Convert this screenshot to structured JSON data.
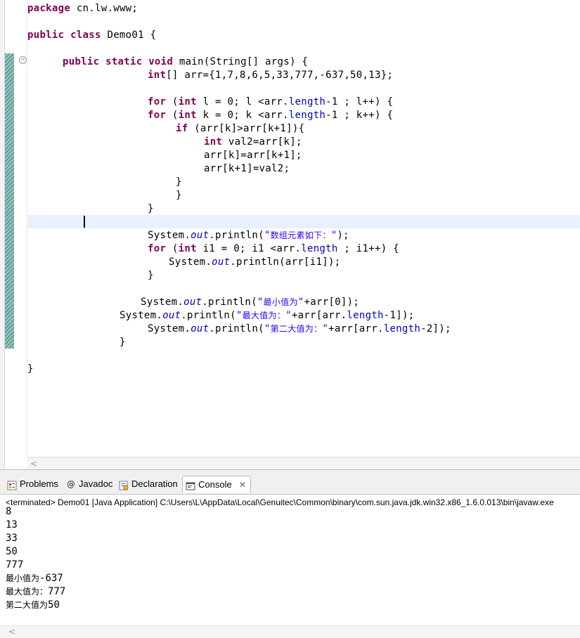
{
  "editor": {
    "fold_toggle": "−",
    "lines": {
      "l1_kw": "package",
      "l1_rest": " cn.lw.www;",
      "l2_kw": "public class",
      "l2_rest": " Demo01 {",
      "l3_kw": "public static void",
      "l3_rest": " main(String[] args) {",
      "l4_kw": "int",
      "l4_rest": "[] arr={1,7,8,6,5,33,777,-637,50,13};",
      "l5_kw": "for",
      "l5_a": " (",
      "l5_kw2": "int",
      "l5_b": " l = 0; l <arr.",
      "l5_f": "length",
      "l5_c": "-1 ; l++) {",
      "l6_kw": "for",
      "l6_a": " (",
      "l6_kw2": "int",
      "l6_b": " k = 0; k <arr.",
      "l6_f": "length",
      "l6_c": "-1 ; k++) {",
      "l7_kw": "if",
      "l7_rest": " (arr[k]>arr[k+1]){",
      "l8_kw": "int",
      "l8_rest": " val2=arr[k];",
      "l9": "arr[k]=arr[k+1];",
      "l10": "arr[k+1]=val2;",
      "l11": "}",
      "l12": "}",
      "l13": "}",
      "l14_a": "System.",
      "l14_f": "out",
      "l14_b": ".println(",
      "l14_s1": "\"",
      "l14_cjk": "数组元素如下：",
      "l14_s2": "\"",
      "l14_c": ");",
      "l15_kw": "for",
      "l15_a": " (",
      "l15_kw2": "int",
      "l15_b": " i1 = 0; i1 <arr.",
      "l15_f": "length",
      "l15_c": " ; i1++) {",
      "l16_a": "System.",
      "l16_f": "out",
      "l16_b": ".println(arr[i1]);",
      "l17": "}",
      "l18_a": "System.",
      "l18_f": "out",
      "l18_b": ".println(",
      "l18_s1": "\"",
      "l18_cjk": "最小值为",
      "l18_s2": "\"",
      "l18_c": "+arr[0]);",
      "l19_a": "System.",
      "l19_f": "out",
      "l19_b": ".println(",
      "l19_s1": "\"",
      "l19_cjk": "最大值为：",
      "l19_s2": "\"",
      "l19_c": "+arr[arr.",
      "l19_f2": "length",
      "l19_d": "-1]);",
      "l20_a": "System.",
      "l20_f": "out",
      "l20_b": ".println(",
      "l20_s1": "\"",
      "l20_cjk": "第二大值为：",
      "l20_s2": "\"",
      "l20_c": "+arr[arr.",
      "l20_f2": "length",
      "l20_d": "-2]);",
      "l21": "}",
      "l22": "}"
    },
    "scroll_arrow": "<"
  },
  "panel": {
    "tabs": [
      {
        "label": "Problems"
      },
      {
        "label": "Javadoc"
      },
      {
        "label": "Declaration"
      },
      {
        "label": "Console",
        "close": "✕"
      }
    ],
    "status": "<terminated> Demo01 [Java Application] C:\\Users\\L\\AppData\\Local\\Genuitec\\Common\\binary\\com.sun.java.jdk.win32.x86_1.6.0.013\\bin\\javaw.exe",
    "output": {
      "o1": "8",
      "o2": "13",
      "o3": "33",
      "o4": "50",
      "o5": "777",
      "o6_cjk": "最小值为",
      "o6_val": "-637",
      "o7_cjk": "最大值为：",
      "o7_val": "777",
      "o8_cjk": "第二大值为",
      "o8_val": "50"
    },
    "scroll_arrow": "<"
  },
  "colors": {
    "keyword": "#7f0055",
    "field": "#0000c0",
    "string": "#2a00ff",
    "current_line": "#e8f2fe",
    "diff_bar": "#5f9f98"
  }
}
